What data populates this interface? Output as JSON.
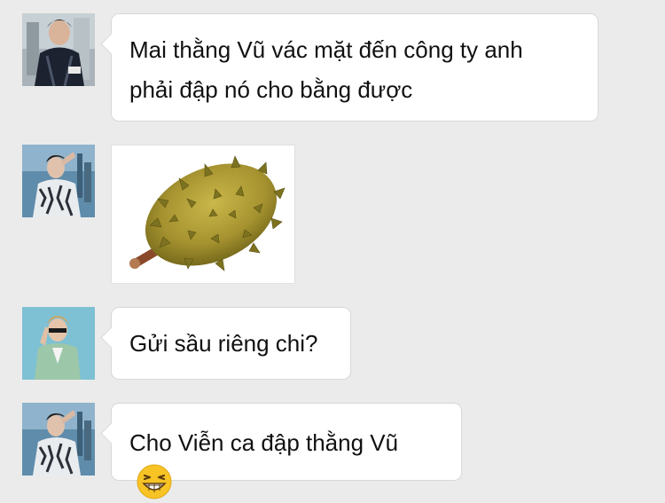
{
  "messages": [
    {
      "type": "text",
      "avatar": "avatar-man-dark-jacket",
      "text": "Mai thằng Vũ vác mặt đến công ty anh\nphải đập nó cho bằng được"
    },
    {
      "type": "image",
      "avatar": "avatar-man-patterned-shirt",
      "image": "durian-image"
    },
    {
      "type": "text",
      "avatar": "avatar-man-blue-suit",
      "text": "Gửi sầu riêng chi?"
    },
    {
      "type": "text",
      "avatar": "avatar-man-patterned-shirt",
      "text": "Cho Viễn ca đập thằng Vũ",
      "emoji": "grinning-squinting-emoji"
    }
  ],
  "colors": {
    "background": "#ebebeb",
    "bubble": "#ffffff",
    "bubble_border": "#d8d8d8",
    "text": "#111111"
  }
}
